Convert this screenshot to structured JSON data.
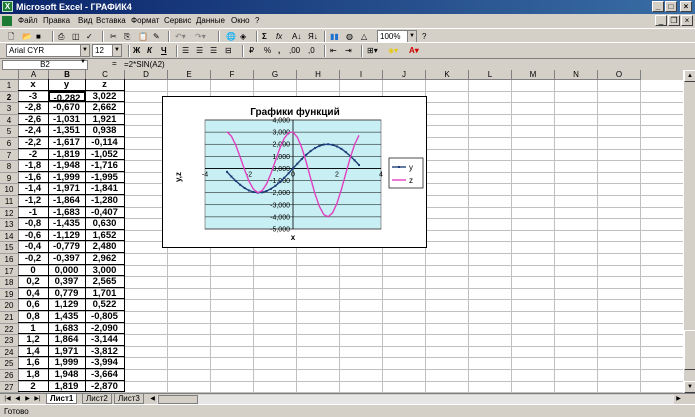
{
  "window": {
    "title": "Microsoft Excel - ГРАФИК4"
  },
  "menu": [
    "Файл",
    "Правка",
    "Вид",
    "Вставка",
    "Формат",
    "Сервис",
    "Данные",
    "Окно",
    "?"
  ],
  "toolbar": {
    "zoom": "100%",
    "font": "Arial CYR",
    "size": "12",
    "sum_label": "Σ",
    "fx_label": "fx",
    "bold": "Ж",
    "italic": "К",
    "underline": "Ч"
  },
  "formula_bar": {
    "name_box": "B2",
    "equals": "=",
    "formula": "=2*SIN(A2)"
  },
  "columns": [
    "A",
    "B",
    "C",
    "D",
    "E",
    "F",
    "G",
    "H",
    "I",
    "J",
    "K",
    "L",
    "M",
    "N",
    "O"
  ],
  "rows": [
    "1",
    "2",
    "3",
    "4",
    "5",
    "6",
    "7",
    "8",
    "9",
    "10",
    "11",
    "12",
    "13",
    "14",
    "15",
    "16",
    "17",
    "18",
    "19",
    "20",
    "21",
    "22",
    "23",
    "24",
    "25",
    "26",
    "27"
  ],
  "table": {
    "headers": [
      "x",
      "y",
      "z"
    ],
    "rows": [
      [
        "-3",
        "-0,282",
        "3,022"
      ],
      [
        "-2,8",
        "-0,670",
        "2,662"
      ],
      [
        "-2,6",
        "-1,031",
        "1,921"
      ],
      [
        "-2,4",
        "-1,351",
        "0,938"
      ],
      [
        "-2,2",
        "-1,617",
        "-0,114"
      ],
      [
        "-2",
        "-1,819",
        "-1,052"
      ],
      [
        "-1,8",
        "-1,948",
        "-1,716"
      ],
      [
        "-1,6",
        "-1,999",
        "-1,995"
      ],
      [
        "-1,4",
        "-1,971",
        "-1,841"
      ],
      [
        "-1,2",
        "-1,864",
        "-1,280"
      ],
      [
        "-1",
        "-1,683",
        "-0,407"
      ],
      [
        "-0,8",
        "-1,435",
        "0,630"
      ],
      [
        "-0,6",
        "-1,129",
        "1,652"
      ],
      [
        "-0,4",
        "-0,779",
        "2,480"
      ],
      [
        "-0,2",
        "-0,397",
        "2,962"
      ],
      [
        "0",
        "0,000",
        "3,000"
      ],
      [
        "0,2",
        "0,397",
        "2,565"
      ],
      [
        "0,4",
        "0,779",
        "1,701"
      ],
      [
        "0,6",
        "1,129",
        "0,522"
      ],
      [
        "0,8",
        "1,435",
        "-0,805"
      ],
      [
        "1",
        "1,683",
        "-2,090"
      ],
      [
        "1,2",
        "1,864",
        "-3,144"
      ],
      [
        "1,4",
        "1,971",
        "-3,812"
      ],
      [
        "1,6",
        "1,999",
        "-3,994"
      ],
      [
        "1,8",
        "1,948",
        "-3,664"
      ],
      [
        "2",
        "1,819",
        "-2,870"
      ]
    ]
  },
  "chart_data": {
    "type": "line",
    "title": "Графики функций",
    "xlabel": "x",
    "ylabel": "y,z",
    "xlim": [
      -4,
      4
    ],
    "ylim": [
      -5,
      4
    ],
    "x_ticks": [
      "-4",
      "-2",
      "0",
      "2",
      "4"
    ],
    "y_ticks": [
      "4,000",
      "3,000",
      "2,000",
      "1,000",
      "0,000",
      "-1,000",
      "-2,000",
      "-3,000",
      "-4,000",
      "-5,000"
    ],
    "legend_position": "right",
    "x": [
      -3,
      -2.8,
      -2.6,
      -2.4,
      -2.2,
      -2,
      -1.8,
      -1.6,
      -1.4,
      -1.2,
      -1,
      -0.8,
      -0.6,
      -0.4,
      -0.2,
      0,
      0.2,
      0.4,
      0.6,
      0.8,
      1,
      1.2,
      1.4,
      1.6,
      1.8,
      2,
      2.2,
      2.4,
      2.6,
      2.8,
      3
    ],
    "series": [
      {
        "name": "y",
        "color": "#1f3f7a",
        "values": [
          -0.282,
          -0.67,
          -1.031,
          -1.351,
          -1.617,
          -1.819,
          -1.948,
          -1.999,
          -1.971,
          -1.864,
          -1.683,
          -1.435,
          -1.129,
          -0.779,
          -0.397,
          0.0,
          0.397,
          0.779,
          1.129,
          1.435,
          1.683,
          1.864,
          1.971,
          1.999,
          1.948,
          1.819,
          1.617,
          1.351,
          1.031,
          0.67,
          0.282
        ]
      },
      {
        "name": "z",
        "color": "#e040c0",
        "values": [
          3.022,
          2.662,
          1.921,
          0.938,
          -0.114,
          -1.052,
          -1.716,
          -1.995,
          -1.841,
          -1.28,
          -0.407,
          0.63,
          1.652,
          2.48,
          2.962,
          3.0,
          2.565,
          1.701,
          0.522,
          -0.805,
          -2.09,
          -3.144,
          -3.812,
          -3.994,
          -3.664,
          -2.87,
          -1.73,
          -0.42,
          0.87,
          1.98,
          2.74
        ]
      }
    ]
  },
  "sheet_tabs": [
    "Лист1",
    "Лист2",
    "Лист3"
  ],
  "status": "Готово"
}
